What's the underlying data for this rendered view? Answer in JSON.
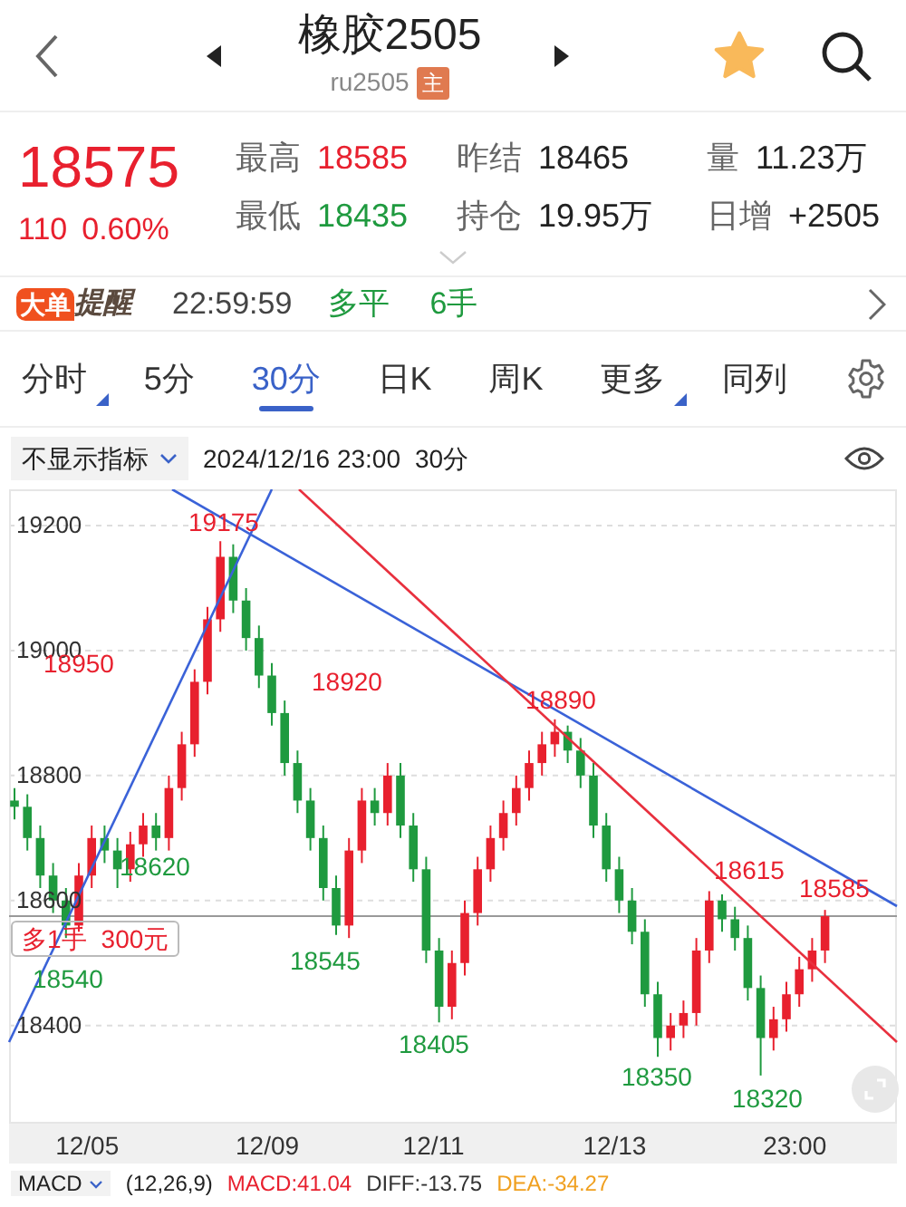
{
  "header": {
    "title": "橡胶2505",
    "symbol": "ru2505",
    "badge": "主",
    "favorite": true
  },
  "quote": {
    "price": "18575",
    "change": "110",
    "change_pct": "0.60%",
    "rising": true,
    "stats": [
      {
        "label": "最高",
        "value": "18585",
        "color": "#e8202e"
      },
      {
        "label": "昨结",
        "value": "18465",
        "color": "#222222"
      },
      {
        "label": "量",
        "value": "11.23万",
        "color": "#222222"
      },
      {
        "label": "最低",
        "value": "18435",
        "color": "#1f9a3f"
      },
      {
        "label": "持仓",
        "value": "19.95万",
        "color": "#222222"
      },
      {
        "label": "日增",
        "value": "+2505",
        "color": "#222222"
      }
    ]
  },
  "alert": {
    "tag": "大单",
    "tag_text": "提醒",
    "time": "22:59:59",
    "action": "多平",
    "lots": "6手"
  },
  "period_tabs": [
    {
      "label": "分时",
      "selected": false,
      "has_menu": true
    },
    {
      "label": "5分",
      "selected": false,
      "has_menu": false
    },
    {
      "label": "30分",
      "selected": true,
      "has_menu": false
    },
    {
      "label": "日K",
      "selected": false,
      "has_menu": false
    },
    {
      "label": "周K",
      "selected": false,
      "has_menu": false
    },
    {
      "label": "更多",
      "selected": false,
      "has_menu": true
    },
    {
      "label": "同列",
      "selected": false,
      "has_menu": false
    }
  ],
  "toolbar": {
    "indicator": "不显示指标",
    "timestamp": "2024/12/16 23:00",
    "period": "30分"
  },
  "chart": {
    "chart_data": {
      "type": "candlestick",
      "grid": true,
      "ylim": [
        18243,
        19258
      ],
      "ref_lines": [
        {
          "axis": "y",
          "value": 18575
        }
      ],
      "yticks": [
        {
          "value": 19200,
          "label": "19200"
        },
        {
          "value": 19000,
          "label": "19000"
        },
        {
          "value": 18800,
          "label": "18800"
        },
        {
          "value": 18600,
          "label": "18600"
        },
        {
          "value": 18400,
          "label": "18400"
        }
      ],
      "ohlc": [
        [
          18760,
          18780,
          18730,
          18750
        ],
        [
          18750,
          18770,
          18680,
          18700
        ],
        [
          18700,
          18720,
          18620,
          18640
        ],
        [
          18640,
          18660,
          18580,
          18600
        ],
        [
          18600,
          18620,
          18540,
          18560
        ],
        [
          18560,
          18660,
          18550,
          18640
        ],
        [
          18640,
          18720,
          18620,
          18700
        ],
        [
          18700,
          18720,
          18660,
          18680
        ],
        [
          18680,
          18700,
          18620,
          18650
        ],
        [
          18650,
          18710,
          18630,
          18690
        ],
        [
          18690,
          18740,
          18670,
          18720
        ],
        [
          18720,
          18740,
          18680,
          18700
        ],
        [
          18700,
          18800,
          18680,
          18780
        ],
        [
          18780,
          18870,
          18760,
          18850
        ],
        [
          18850,
          18970,
          18830,
          18950
        ],
        [
          18950,
          19070,
          18930,
          19050
        ],
        [
          19050,
          19175,
          19030,
          19150
        ],
        [
          19150,
          19170,
          19060,
          19080
        ],
        [
          19080,
          19100,
          19000,
          19020
        ],
        [
          19020,
          19040,
          18940,
          18960
        ],
        [
          18960,
          18980,
          18880,
          18900
        ],
        [
          18900,
          18920,
          18800,
          18820
        ],
        [
          18820,
          18840,
          18740,
          18760
        ],
        [
          18760,
          18780,
          18680,
          18700
        ],
        [
          18700,
          18720,
          18600,
          18620
        ],
        [
          18620,
          18640,
          18545,
          18560
        ],
        [
          18560,
          18700,
          18540,
          18680
        ],
        [
          18680,
          18780,
          18660,
          18760
        ],
        [
          18760,
          18780,
          18720,
          18740
        ],
        [
          18740,
          18820,
          18720,
          18800
        ],
        [
          18800,
          18820,
          18700,
          18720
        ],
        [
          18720,
          18740,
          18630,
          18650
        ],
        [
          18650,
          18670,
          18500,
          18520
        ],
        [
          18520,
          18540,
          18405,
          18430
        ],
        [
          18430,
          18520,
          18410,
          18500
        ],
        [
          18500,
          18600,
          18480,
          18580
        ],
        [
          18580,
          18670,
          18560,
          18650
        ],
        [
          18650,
          18720,
          18630,
          18700
        ],
        [
          18700,
          18760,
          18680,
          18740
        ],
        [
          18740,
          18800,
          18720,
          18780
        ],
        [
          18780,
          18840,
          18760,
          18820
        ],
        [
          18820,
          18870,
          18800,
          18850
        ],
        [
          18850,
          18890,
          18830,
          18870
        ],
        [
          18870,
          18880,
          18820,
          18840
        ],
        [
          18840,
          18860,
          18780,
          18800
        ],
        [
          18800,
          18820,
          18700,
          18720
        ],
        [
          18720,
          18740,
          18630,
          18650
        ],
        [
          18650,
          18670,
          18580,
          18600
        ],
        [
          18600,
          18620,
          18530,
          18550
        ],
        [
          18550,
          18570,
          18430,
          18450
        ],
        [
          18450,
          18470,
          18350,
          18380
        ],
        [
          18380,
          18420,
          18360,
          18400
        ],
        [
          18400,
          18440,
          18380,
          18420
        ],
        [
          18420,
          18540,
          18400,
          18520
        ],
        [
          18520,
          18615,
          18500,
          18600
        ],
        [
          18600,
          18610,
          18550,
          18570
        ],
        [
          18570,
          18590,
          18520,
          18540
        ],
        [
          18540,
          18560,
          18440,
          18460
        ],
        [
          18460,
          18480,
          18320,
          18380
        ],
        [
          18380,
          18430,
          18360,
          18410
        ],
        [
          18410,
          18470,
          18390,
          18450
        ],
        [
          18450,
          18510,
          18430,
          18490
        ],
        [
          18490,
          18540,
          18470,
          18520
        ],
        [
          18520,
          18585,
          18500,
          18575
        ]
      ]
    },
    "price_labels": [
      {
        "text": "19175",
        "color": "#e8202e"
      },
      {
        "text": "18950",
        "color": "#e8202e"
      },
      {
        "text": "18920",
        "color": "#e8202e"
      },
      {
        "text": "18890",
        "color": "#e8202e"
      },
      {
        "text": "18615",
        "color": "#e8202e"
      },
      {
        "text": "18585",
        "color": "#e8202e"
      },
      {
        "text": "18620",
        "color": "#1f9a3f"
      },
      {
        "text": "18540",
        "color": "#1f9a3f"
      },
      {
        "text": "18545",
        "color": "#1f9a3f"
      },
      {
        "text": "18405",
        "color": "#1f9a3f"
      },
      {
        "text": "18350",
        "color": "#1f9a3f"
      },
      {
        "text": "18320",
        "color": "#1f9a3f"
      }
    ],
    "position": {
      "side": "多1手",
      "profit": "300元"
    },
    "x_labels": [
      "12/05",
      "12/09",
      "12/11",
      "12/13",
      "23:00"
    ]
  },
  "macd": {
    "name": "MACD",
    "params": "(12,26,9)",
    "values": [
      {
        "text": "MACD:41.04",
        "color": "#e8202e"
      },
      {
        "text": "DIFF:-13.75",
        "color": "#333333"
      },
      {
        "text": "DEA:-34.27",
        "color": "#f0a020"
      }
    ]
  }
}
